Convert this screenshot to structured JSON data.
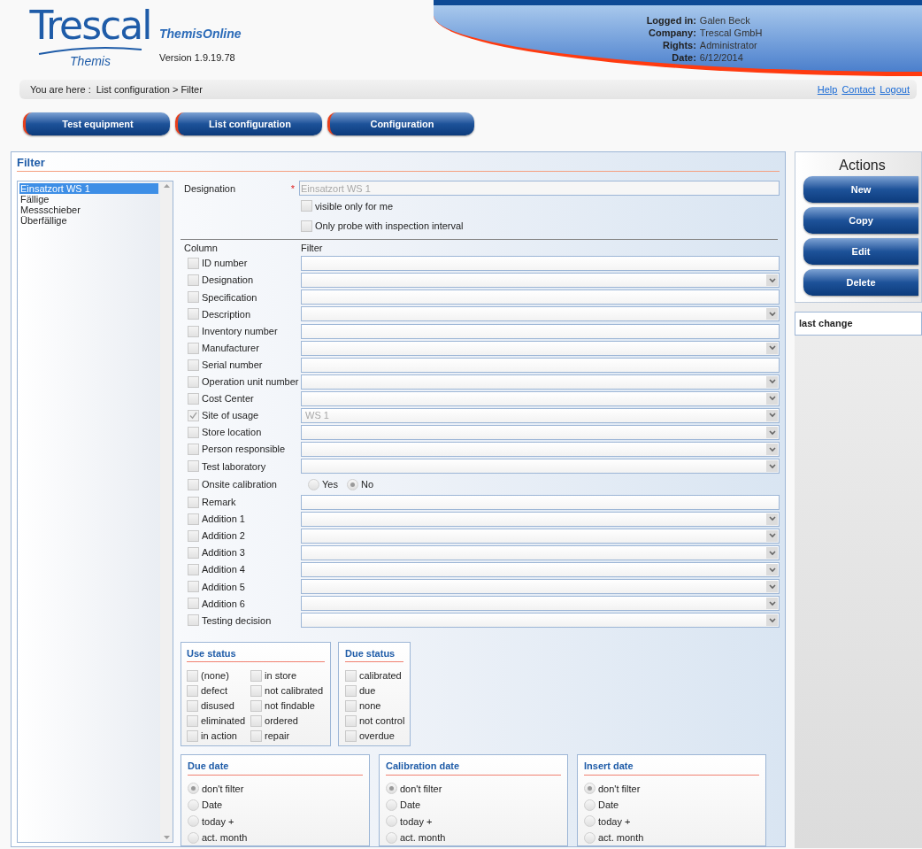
{
  "header": {
    "logo": {
      "wordmark": "Trescal",
      "subtitle": "Themis"
    },
    "app_name": "ThemisOnline",
    "version": "Version 1.9.19.78",
    "user_info": [
      {
        "label": "Logged in:",
        "value": "Galen Beck"
      },
      {
        "label": "Company:",
        "value": "Trescal GmbH"
      },
      {
        "label": "Rights:",
        "value": "Administrator"
      },
      {
        "label": "Date:",
        "value": "6/12/2014"
      }
    ]
  },
  "breadcrumb": {
    "prefix": "You are here :",
    "path": "List configuration > Filter"
  },
  "links": [
    "Help",
    "Contact",
    "Logout"
  ],
  "nav_tabs": [
    "Test equipment",
    "List configuration",
    "Configuration"
  ],
  "filter": {
    "title": "Filter",
    "list": [
      {
        "label": "Einsatzort WS 1",
        "selected": true
      },
      {
        "label": "Fällige",
        "selected": false
      },
      {
        "label": "Messschieber",
        "selected": false
      },
      {
        "label": "Überfällige",
        "selected": false
      }
    ],
    "designation": {
      "label": "Designation",
      "required_mark": "*",
      "value": "Einsatzort WS 1"
    },
    "options": [
      {
        "label": "visible only for me",
        "checked": false
      },
      {
        "label": "Only probe with inspection interval",
        "checked": false
      }
    ],
    "column_header": "Column",
    "filter_header": "Filter",
    "columns": [
      {
        "label": "ID number",
        "checked": false,
        "kind": "text"
      },
      {
        "label": "Designation",
        "checked": false,
        "kind": "select"
      },
      {
        "label": "Specification",
        "checked": false,
        "kind": "text"
      },
      {
        "label": "Description",
        "checked": false,
        "kind": "select"
      },
      {
        "label": "Inventory number",
        "checked": false,
        "kind": "text"
      },
      {
        "label": "Manufacturer",
        "checked": false,
        "kind": "select"
      },
      {
        "label": "Serial number",
        "checked": false,
        "kind": "text"
      },
      {
        "label": "Operation unit number",
        "checked": false,
        "kind": "select"
      },
      {
        "label": "Cost Center",
        "checked": false,
        "kind": "select"
      },
      {
        "label": "Site of usage",
        "checked": true,
        "kind": "select",
        "value": "WS 1"
      },
      {
        "label": "Store location",
        "checked": false,
        "kind": "select"
      },
      {
        "label": "Person responsible",
        "checked": false,
        "kind": "select"
      },
      {
        "label": "Test laboratory",
        "checked": false,
        "kind": "select"
      },
      {
        "label": "Onsite calibration",
        "checked": false,
        "kind": "radio",
        "options": [
          {
            "label": "Yes",
            "selected": false
          },
          {
            "label": "No",
            "selected": true
          }
        ]
      },
      {
        "label": "Remark",
        "checked": false,
        "kind": "text"
      },
      {
        "label": "Addition 1",
        "checked": false,
        "kind": "select"
      },
      {
        "label": "Addition 2",
        "checked": false,
        "kind": "select"
      },
      {
        "label": "Addition 3",
        "checked": false,
        "kind": "select"
      },
      {
        "label": "Addition 4",
        "checked": false,
        "kind": "select"
      },
      {
        "label": "Addition 5",
        "checked": false,
        "kind": "select"
      },
      {
        "label": "Addition 6",
        "checked": false,
        "kind": "select"
      },
      {
        "label": "Testing decision",
        "checked": false,
        "kind": "select"
      }
    ],
    "use_status": {
      "title": "Use status",
      "items": [
        {
          "label": "(none)",
          "checked": false
        },
        {
          "label": "defect",
          "checked": false
        },
        {
          "label": "disused",
          "checked": false
        },
        {
          "label": "eliminated",
          "checked": false
        },
        {
          "label": "in action",
          "checked": false
        },
        {
          "label": "in store",
          "checked": false
        },
        {
          "label": "not calibrated",
          "checked": false
        },
        {
          "label": "not findable",
          "checked": false
        },
        {
          "label": "ordered",
          "checked": false
        },
        {
          "label": "repair",
          "checked": false
        }
      ]
    },
    "due_status": {
      "title": "Due status",
      "items": [
        {
          "label": "calibrated",
          "checked": false
        },
        {
          "label": "due",
          "checked": false
        },
        {
          "label": "none",
          "checked": false
        },
        {
          "label": "not control",
          "checked": false
        },
        {
          "label": "overdue",
          "checked": false
        }
      ]
    },
    "date_groups": [
      {
        "title": "Due date",
        "options": [
          {
            "label": "don't filter",
            "selected": true
          },
          {
            "label": "Date",
            "selected": false
          },
          {
            "label": "today +",
            "selected": false
          },
          {
            "label": "act. month",
            "selected": false
          }
        ]
      },
      {
        "title": "Calibration date",
        "options": [
          {
            "label": "don't filter",
            "selected": true
          },
          {
            "label": "Date",
            "selected": false
          },
          {
            "label": "today +",
            "selected": false
          },
          {
            "label": "act. month",
            "selected": false
          }
        ]
      },
      {
        "title": "Insert date",
        "options": [
          {
            "label": "don't filter",
            "selected": true
          },
          {
            "label": "Date",
            "selected": false
          },
          {
            "label": "today +",
            "selected": false
          },
          {
            "label": "act. month",
            "selected": false
          }
        ]
      }
    ]
  },
  "actions": {
    "title": "Actions",
    "buttons": [
      "New",
      "Copy",
      "Edit",
      "Delete"
    ]
  },
  "last_change": {
    "label": "last change"
  }
}
